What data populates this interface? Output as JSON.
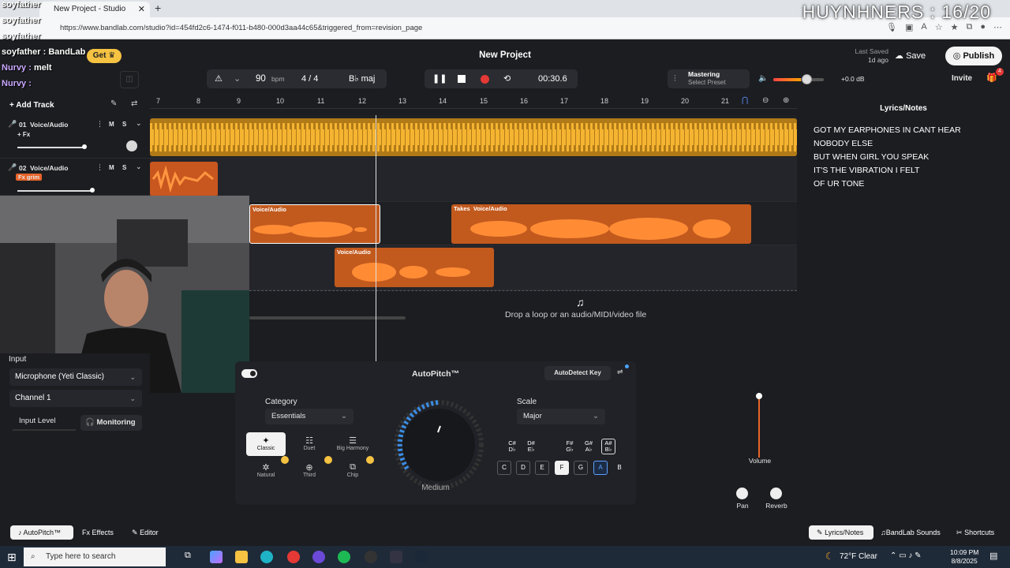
{
  "browser": {
    "tab_title": "New Project - Studio",
    "url": "https://www.bandlab.com/studio?id=454fd2c6-1474-f011-b480-000d3aa44c65&triggered_from=revision_page"
  },
  "overlay_title": "HUYNHNERS : 16/20",
  "chat": [
    {
      "name": "soyfather",
      "msg": ""
    },
    {
      "name": "soyfather",
      "msg": ""
    },
    {
      "name": "soyfather",
      "msg": ""
    },
    {
      "name": "soyfather :",
      "msg": "BandLab"
    },
    {
      "name": "Nurvy :",
      "msg": "melt"
    },
    {
      "name": "Nurvy :",
      "msg": ""
    }
  ],
  "header": {
    "get_label": "Get",
    "project_title": "New Project",
    "last_saved_label": "Last Saved",
    "last_saved_value": "1d ago",
    "save_label": "Save",
    "publish_label": "Publish",
    "invite_label": "Invite",
    "notification_count": "4"
  },
  "transport": {
    "bpm_value": "90",
    "bpm_unit": "bpm",
    "time_signature": "4 / 4",
    "key": "B♭ maj",
    "time": "00:30.6",
    "mastering_label": "Mastering",
    "mastering_sub": "Select Preset",
    "volume_db": "+0.0 dB",
    "volume_level": 0.55
  },
  "ruler_ticks": [
    "7",
    "8",
    "9",
    "10",
    "11",
    "12",
    "13",
    "14",
    "15",
    "16",
    "17",
    "18",
    "19",
    "20",
    "21"
  ],
  "tracks": [
    {
      "number": "01",
      "name": "Voice/Audio",
      "fx": "+ Fx",
      "fx_active": false
    },
    {
      "number": "02",
      "name": "Voice/Audio",
      "fx": "Fx grim",
      "fx_active": true
    }
  ],
  "track_buttons": {
    "mute": "M",
    "solo": "S"
  },
  "add_track_label": "Add Track",
  "clips": [
    {
      "label": "Voice/Audio"
    },
    {
      "label": "Takes",
      "label2": "Voice/Audio"
    },
    {
      "label": "Voice/Audio"
    }
  ],
  "drop_text": "Drop a loop or an audio/MIDI/video file",
  "lyrics": {
    "title": "Lyrics/Notes",
    "lines": [
      "GOT MY EARPHONES IN CANT HEAR",
      "NOBODY ELSE",
      "BUT WHEN GIRL YOU SPEAK",
      "IT'S THE VIBRATION I FELT",
      "OF UR TONE"
    ]
  },
  "input_panel": {
    "title": "Input",
    "device": "Microphone (Yeti Classic)",
    "channel": "Channel 1",
    "input_level_label": "Input Level",
    "monitoring_label": "Monitoring"
  },
  "autopitch": {
    "title": "AutoPitch™",
    "autodetect_label": "AutoDetect Key",
    "category_label": "Category",
    "category_value": "Essentials",
    "modes": [
      {
        "label": "Classic",
        "selected": true
      },
      {
        "label": "Duet",
        "selected": false
      },
      {
        "label": "Big Harmony",
        "selected": false
      },
      {
        "label": "Natural",
        "selected": false
      },
      {
        "label": "Third",
        "selected": false
      },
      {
        "label": "Chip",
        "selected": false
      }
    ],
    "knob_label": "Medium",
    "scale_label": "Scale",
    "scale_value": "Major",
    "sharps": [
      "C#\nD♭",
      "D#\nE♭",
      "F#\nG♭",
      "G#\nA♭",
      "A#\nB♭"
    ],
    "naturals": [
      "C",
      "D",
      "E",
      "F",
      "G",
      "A",
      "B"
    ]
  },
  "mixer": {
    "volume_label": "Volume",
    "pan_label": "Pan",
    "reverb_label": "Reverb"
  },
  "bottom_nav": {
    "autopitch": "AutoPitch™",
    "effects": "Effects",
    "editor": "Editor",
    "lyrics": "Lyrics/Notes",
    "sounds": "BandLab Sounds",
    "shortcuts": "Shortcuts"
  },
  "taskbar": {
    "search_placeholder": "Type here to search",
    "weather": "72°F  Clear",
    "time": "10:09 PM",
    "date": "8/8/2025"
  }
}
